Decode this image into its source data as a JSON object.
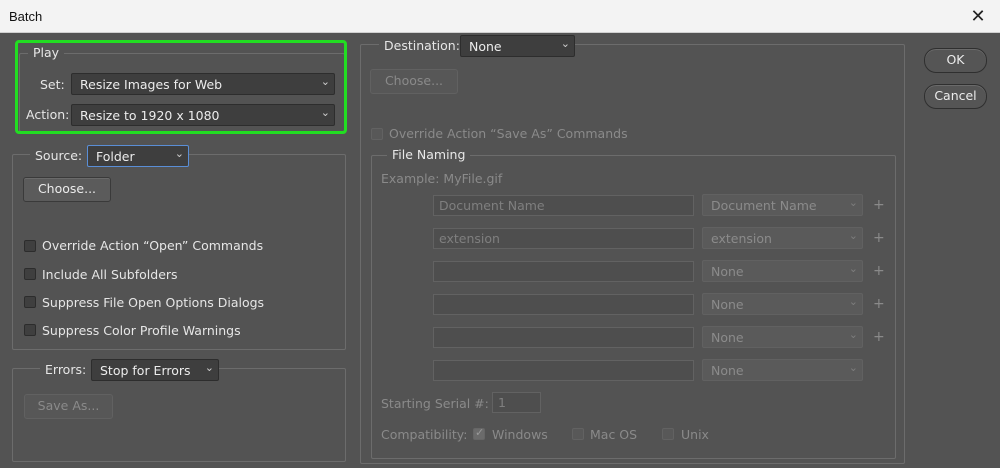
{
  "window": {
    "title": "Batch",
    "close_glyph": "✕"
  },
  "play": {
    "legend": "Play",
    "set_label": "Set:",
    "set_value": "Resize Images for Web",
    "action_label": "Action:",
    "action_value": "Resize to 1920 x 1080"
  },
  "source": {
    "label": "Source:",
    "value": "Folder",
    "choose_label": "Choose...",
    "options": [
      "Override Action “Open” Commands",
      "Include All Subfolders",
      "Suppress File Open Options Dialogs",
      "Suppress Color Profile Warnings"
    ]
  },
  "errors": {
    "label": "Errors:",
    "value": "Stop for Errors",
    "save_as_label": "Save As..."
  },
  "destination": {
    "label": "Destination:",
    "value": "None",
    "choose_label": "Choose...",
    "override_label": "Override Action “Save As” Commands"
  },
  "file_naming": {
    "legend": "File Naming",
    "example": "Example: MyFile.gif",
    "rows": [
      {
        "field": "Document Name",
        "select": "Document Name"
      },
      {
        "field": "extension",
        "select": "extension"
      },
      {
        "field": "",
        "select": "None"
      },
      {
        "field": "",
        "select": "None"
      },
      {
        "field": "",
        "select": "None"
      },
      {
        "field": "",
        "select": "None"
      }
    ],
    "plus_glyph": "+",
    "serial_label": "Starting Serial #:",
    "serial_value": "1",
    "compat_label": "Compatibility:",
    "compat": [
      {
        "label": "Windows",
        "checked": true
      },
      {
        "label": "Mac OS",
        "checked": false
      },
      {
        "label": "Unix",
        "checked": false
      }
    ]
  },
  "buttons": {
    "ok": "OK",
    "cancel": "Cancel"
  },
  "icons": {
    "chevron": "⌄",
    "check": "✓"
  },
  "colors": {
    "highlight": "#22dd22",
    "dialog_bg": "#535353"
  }
}
